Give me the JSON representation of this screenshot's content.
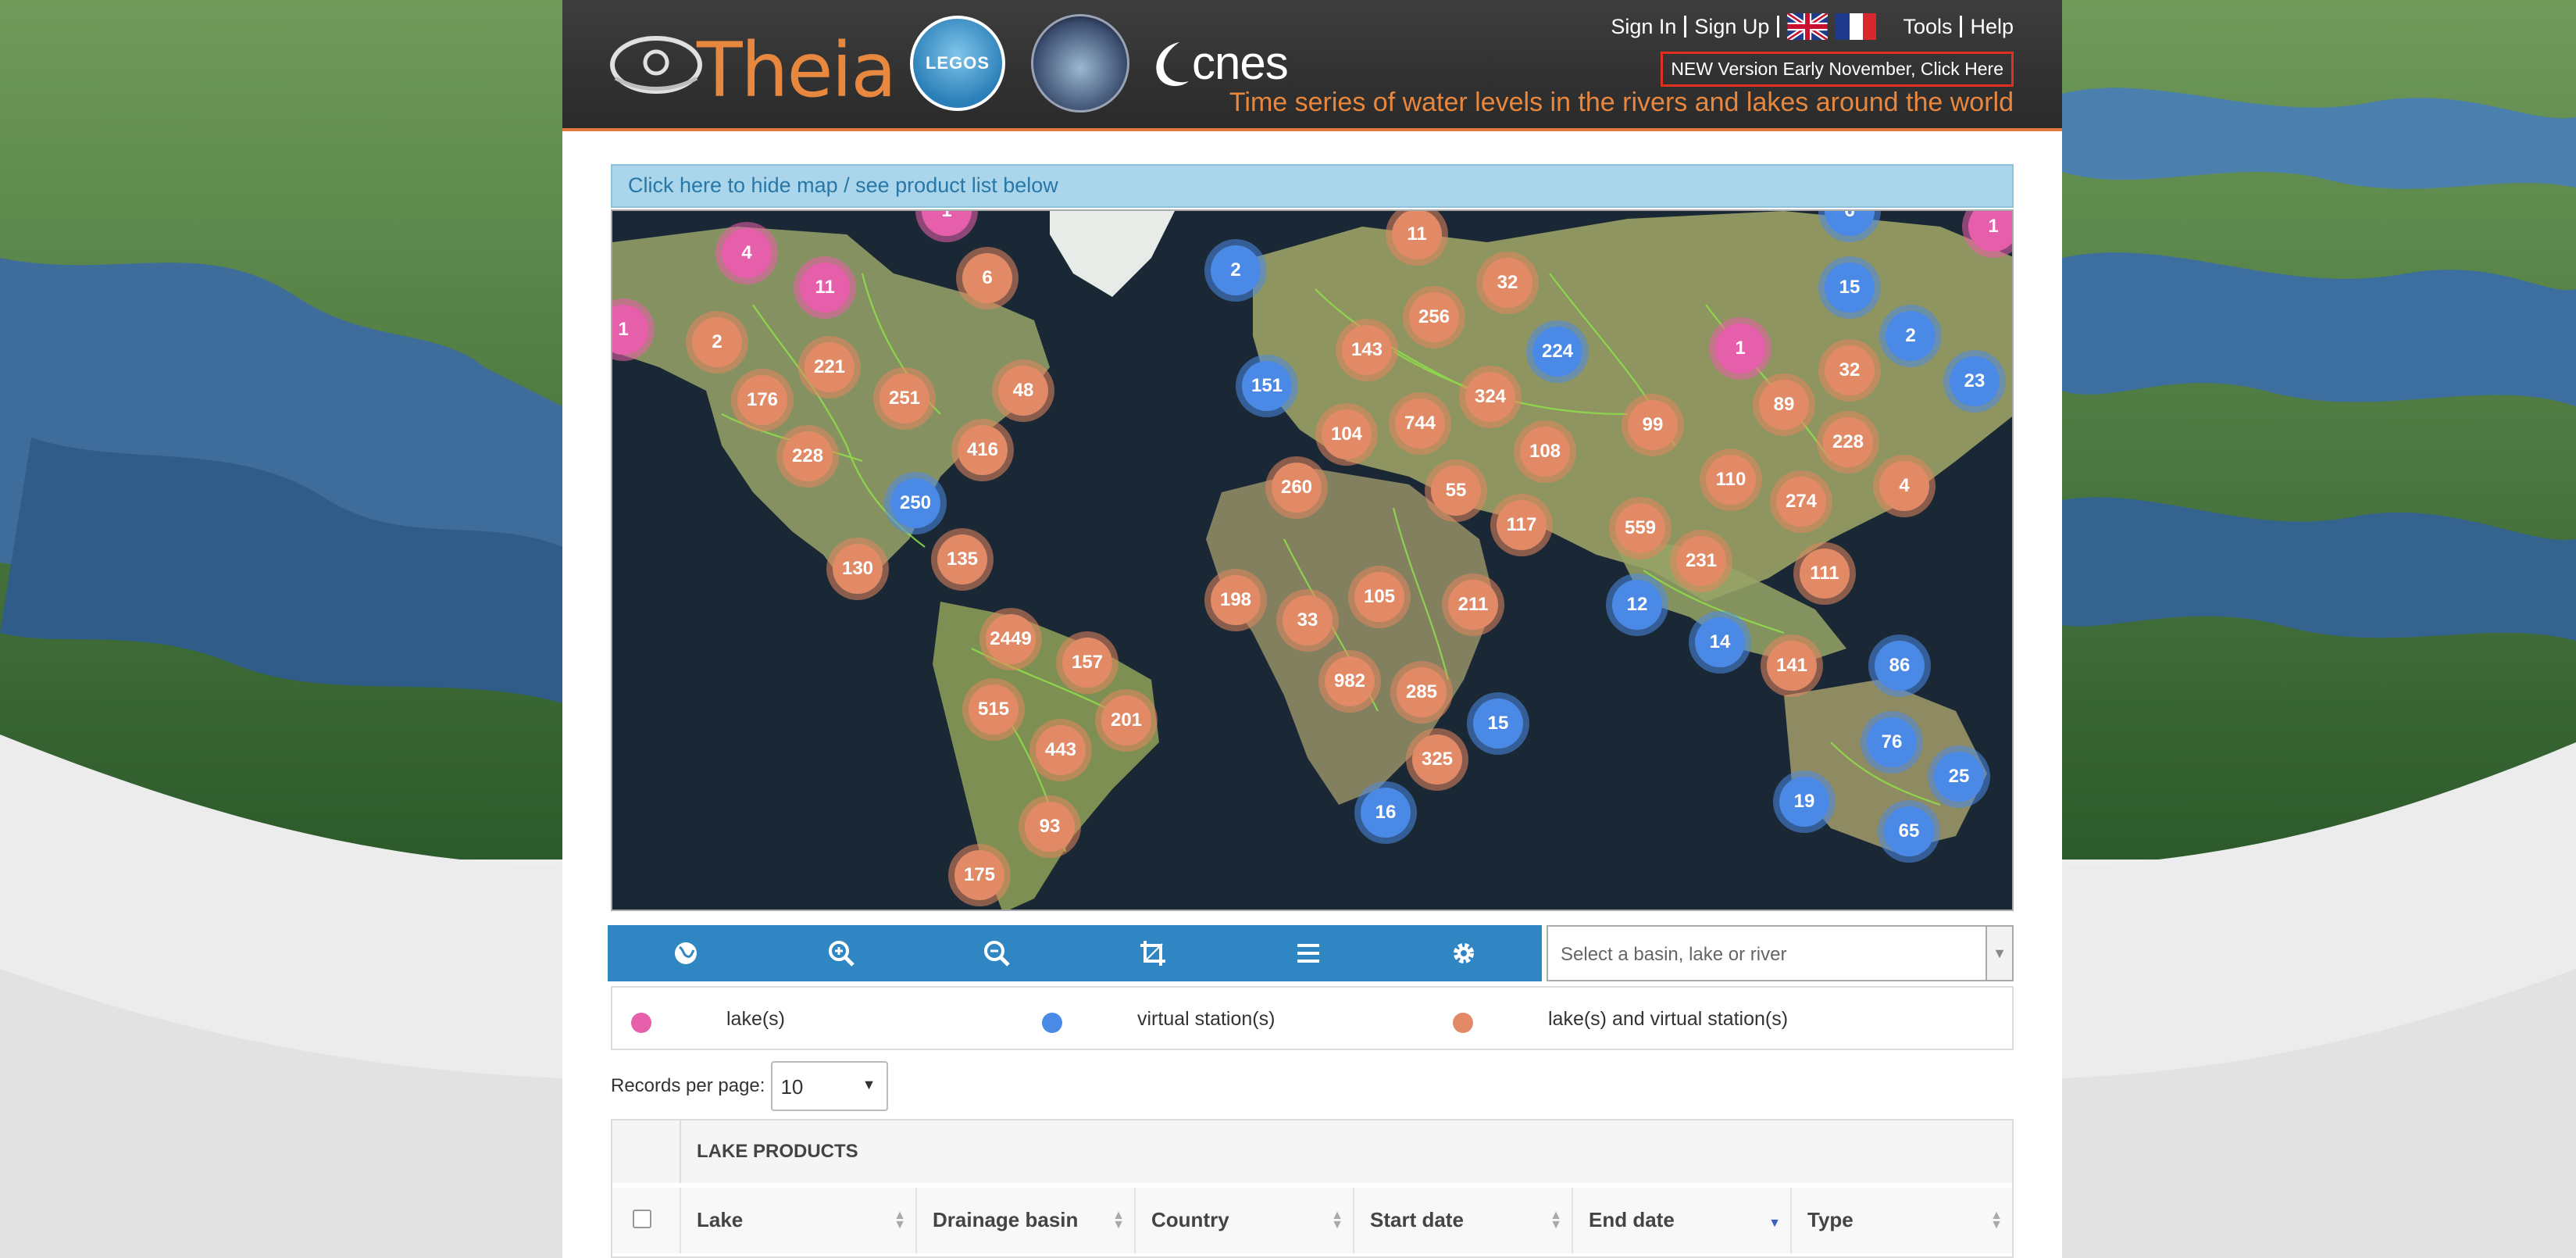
{
  "header": {
    "theia_logo": "Theia",
    "legos_logo": "LEGOS",
    "cnes_logo": "cnes",
    "sign_in": "Sign In",
    "sign_up": "Sign Up",
    "tools": "Tools",
    "help": "Help",
    "new_version": "NEW Version Early November, Click Here",
    "tagline": "Time series of water levels in the rivers and lakes around the world"
  },
  "map_toggle": "Click here to hide map / see product list below",
  "clusters": [
    {
      "label": "1",
      "kind": "pink"
    },
    {
      "label": "4",
      "kind": "pink"
    },
    {
      "label": "11",
      "kind": "pink"
    },
    {
      "label": "1",
      "kind": "pink"
    },
    {
      "label": "6",
      "kind": "orange"
    },
    {
      "label": "2",
      "kind": "orange"
    },
    {
      "label": "176",
      "kind": "orange"
    },
    {
      "label": "221",
      "kind": "orange"
    },
    {
      "label": "251",
      "kind": "orange"
    },
    {
      "label": "48",
      "kind": "orange"
    },
    {
      "label": "228",
      "kind": "orange"
    },
    {
      "label": "416",
      "kind": "orange"
    },
    {
      "label": "250",
      "kind": "blue"
    },
    {
      "label": "130",
      "kind": "orange"
    },
    {
      "label": "135",
      "kind": "orange"
    },
    {
      "label": "2449",
      "kind": "orange"
    },
    {
      "label": "157",
      "kind": "orange"
    },
    {
      "label": "515",
      "kind": "orange"
    },
    {
      "label": "201",
      "kind": "orange"
    },
    {
      "label": "443",
      "kind": "orange"
    },
    {
      "label": "93",
      "kind": "orange"
    },
    {
      "label": "175",
      "kind": "orange"
    },
    {
      "label": "2",
      "kind": "blue"
    },
    {
      "label": "151",
      "kind": "blue"
    },
    {
      "label": "11",
      "kind": "orange"
    },
    {
      "label": "256",
      "kind": "orange"
    },
    {
      "label": "32",
      "kind": "orange"
    },
    {
      "label": "143",
      "kind": "orange"
    },
    {
      "label": "224",
      "kind": "blue"
    },
    {
      "label": "104",
      "kind": "orange"
    },
    {
      "label": "744",
      "kind": "orange"
    },
    {
      "label": "324",
      "kind": "orange"
    },
    {
      "label": "260",
      "kind": "orange"
    },
    {
      "label": "108",
      "kind": "orange"
    },
    {
      "label": "55",
      "kind": "orange"
    },
    {
      "label": "117",
      "kind": "orange"
    },
    {
      "label": "99",
      "kind": "orange"
    },
    {
      "label": "198",
      "kind": "orange"
    },
    {
      "label": "33",
      "kind": "orange"
    },
    {
      "label": "105",
      "kind": "orange"
    },
    {
      "label": "211",
      "kind": "orange"
    },
    {
      "label": "982",
      "kind": "orange"
    },
    {
      "label": "285",
      "kind": "orange"
    },
    {
      "label": "15",
      "kind": "blue"
    },
    {
      "label": "325",
      "kind": "orange"
    },
    {
      "label": "16",
      "kind": "blue"
    },
    {
      "label": "6",
      "kind": "blue"
    },
    {
      "label": "15",
      "kind": "blue"
    },
    {
      "label": "2",
      "kind": "blue"
    },
    {
      "label": "1",
      "kind": "pink"
    },
    {
      "label": "32",
      "kind": "orange"
    },
    {
      "label": "89",
      "kind": "orange"
    },
    {
      "label": "23",
      "kind": "blue"
    },
    {
      "label": "228",
      "kind": "orange"
    },
    {
      "label": "110",
      "kind": "orange"
    },
    {
      "label": "274",
      "kind": "orange"
    },
    {
      "label": "4",
      "kind": "orange"
    },
    {
      "label": "559",
      "kind": "orange"
    },
    {
      "label": "231",
      "kind": "orange"
    },
    {
      "label": "111",
      "kind": "orange"
    },
    {
      "label": "12",
      "kind": "blue"
    },
    {
      "label": "14",
      "kind": "blue"
    },
    {
      "label": "141",
      "kind": "orange"
    },
    {
      "label": "86",
      "kind": "blue"
    },
    {
      "label": "76",
      "kind": "blue"
    },
    {
      "label": "25",
      "kind": "blue"
    },
    {
      "label": "19",
      "kind": "blue"
    },
    {
      "label": "65",
      "kind": "blue"
    },
    {
      "label": "1",
      "kind": "pink"
    }
  ],
  "toolbar": {
    "icons": [
      "globe-icon",
      "zoom-in-icon",
      "zoom-out-icon",
      "crop-icon",
      "list-icon",
      "gear-icon"
    ]
  },
  "basin_select": {
    "placeholder": "Select a basin, lake or river"
  },
  "legend": {
    "lakes": "lake(s)",
    "virtual": "virtual station(s)",
    "both": "lake(s) and virtual station(s)",
    "colors": {
      "lakes": "#e65fab",
      "virtual": "#4a8ae6",
      "both": "#e28a66"
    }
  },
  "records": {
    "label": "Records per page:",
    "value": "10"
  },
  "table": {
    "title": "LAKE PRODUCTS",
    "columns": [
      "Lake",
      "Drainage basin",
      "Country",
      "Start date",
      "End date",
      "Type"
    ]
  }
}
